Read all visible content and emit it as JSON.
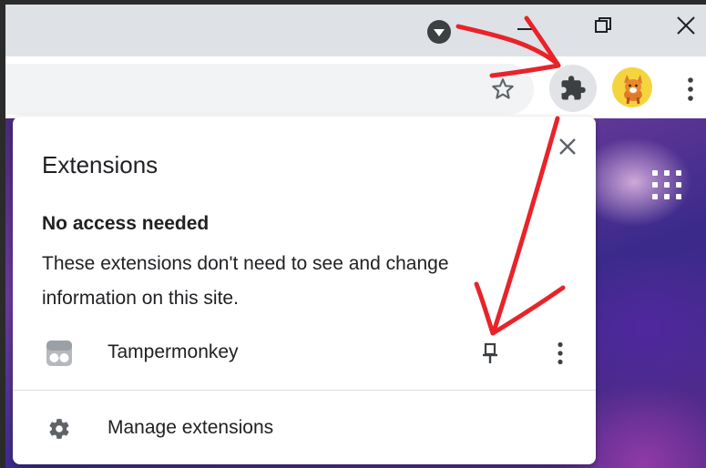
{
  "window": {
    "minimize_label": "Minimize",
    "maximize_label": "Maximize",
    "close_label": "Close"
  },
  "toolbar": {
    "bookmark_icon": "star-icon",
    "extensions_icon": "puzzle-icon",
    "menu_icon": "kebab-icon"
  },
  "popup": {
    "title": "Extensions",
    "section_heading": "No access needed",
    "section_description": "These extensions don't need to see and change information on this site.",
    "extensions": [
      {
        "name": "Tampermonkey"
      }
    ],
    "manage_label": "Manage extensions"
  },
  "colors": {
    "annotation_red": "#e8232a",
    "titlebar": "#dee1e6",
    "popup_text": "#202124"
  }
}
